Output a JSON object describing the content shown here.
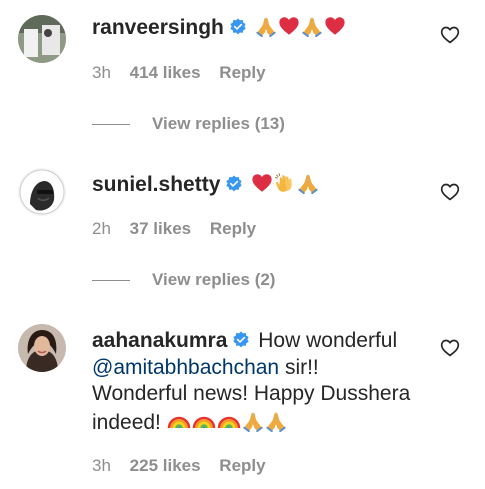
{
  "comments": [
    {
      "username": "ranveersingh",
      "text": "",
      "emojis": [
        "pray",
        "heart",
        "pray",
        "heart"
      ],
      "time": "3h",
      "likes": "414 likes",
      "reply": "Reply",
      "view_replies": "View replies (13)"
    },
    {
      "username": "suniel.shetty",
      "text": "",
      "emojis": [
        "heart",
        "clap",
        "pray"
      ],
      "time": "2h",
      "likes": "37 likes",
      "reply": "Reply",
      "view_replies": "View replies (2)"
    },
    {
      "username": "aahanakumra",
      "text_1": "How wonderful",
      "mention": "@amitabhbachchan",
      "text_2": " sir!!",
      "text_3": "Wonderful news! Happy Dusshera",
      "text_4": "indeed! ",
      "emojis": [
        "rainbow",
        "rainbow",
        "rainbow",
        "pray",
        "pray"
      ],
      "time": "3h",
      "likes": "225 likes",
      "reply": "Reply"
    }
  ],
  "colors": {
    "verified": "#3897f0",
    "secondary_text": "#8e8e8e",
    "mention": "#00376b"
  }
}
